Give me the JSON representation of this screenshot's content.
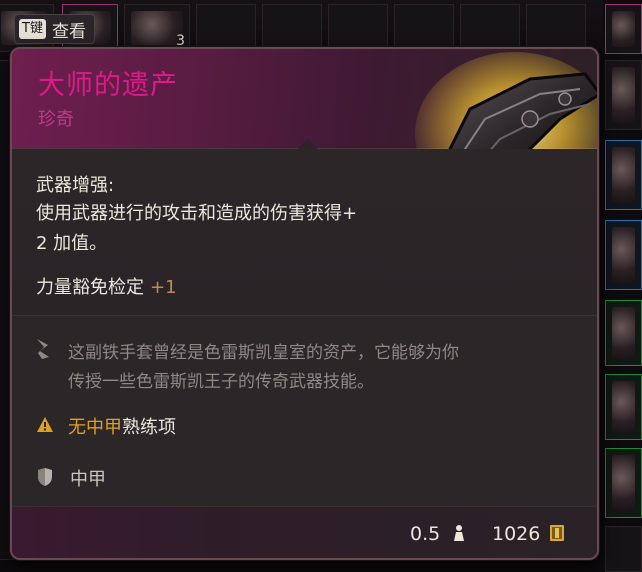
{
  "view_hint": {
    "key": "T键",
    "label": "查看"
  },
  "background": {
    "stack_count": "3"
  },
  "item": {
    "name": "大师的遗产",
    "rarity": "珍奇",
    "name_color": "#e0198a",
    "rarity_color": "#c13a8a",
    "icon": "gauntlets-icon"
  },
  "enchantment": {
    "title": "武器增强:",
    "description_line1": "使用武器进行的攻击和造成的伤害获得+",
    "description_line2": "2 加值。"
  },
  "saving_throw": {
    "label": "力量豁免检定",
    "bonus": "+1"
  },
  "lore": {
    "line1": "这副铁手套曾经是色雷斯凯皇室的资产，它能够为你",
    "line2": "传授一些色雷斯凯王子的传奇武器技能。"
  },
  "proficiency_warning": {
    "highlight": "无中甲",
    "rest": "熟练项"
  },
  "armor_type": "中甲",
  "footer": {
    "weight": "0.5",
    "value": "1026"
  }
}
